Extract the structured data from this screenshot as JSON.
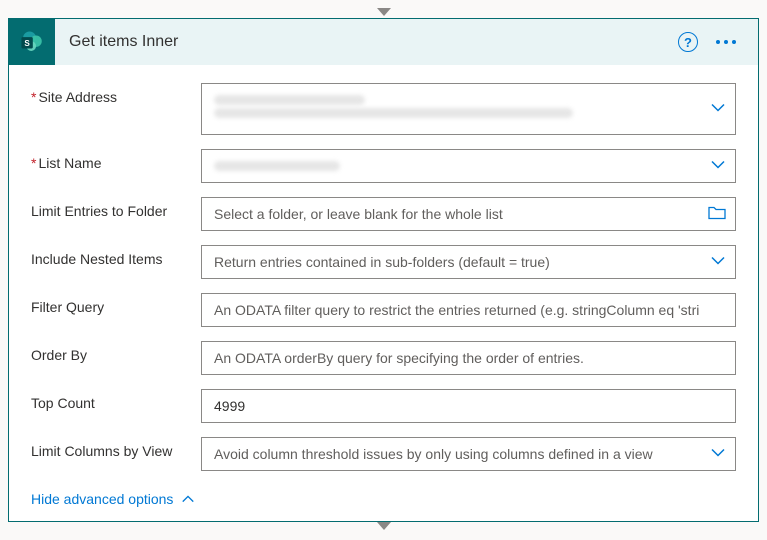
{
  "header": {
    "title": "Get items Inner",
    "icon_name": "sharepoint-icon"
  },
  "fields": {
    "site_address": {
      "label": "Site Address",
      "value_redacted": true
    },
    "list_name": {
      "label": "List Name",
      "value_redacted": true
    },
    "limit_folder": {
      "label": "Limit Entries to Folder",
      "placeholder": "Select a folder, or leave blank for the whole list"
    },
    "include_nested": {
      "label": "Include Nested Items",
      "placeholder": "Return entries contained in sub-folders (default = true)"
    },
    "filter_query": {
      "label": "Filter Query",
      "placeholder": "An ODATA filter query to restrict the entries returned (e.g. stringColumn eq 'stri"
    },
    "order_by": {
      "label": "Order By",
      "placeholder": "An ODATA orderBy query for specifying the order of entries."
    },
    "top_count": {
      "label": "Top Count",
      "value": "4999"
    },
    "limit_columns": {
      "label": "Limit Columns by View",
      "placeholder": "Avoid column threshold issues by only using columns defined in a view"
    }
  },
  "advanced_toggle": "Hide advanced options"
}
